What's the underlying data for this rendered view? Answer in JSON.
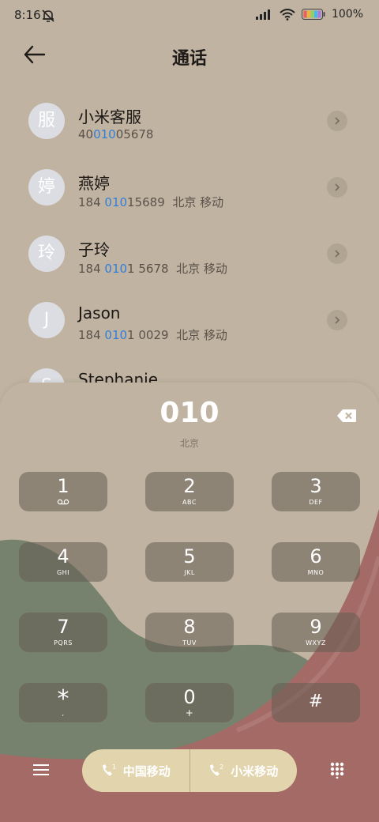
{
  "status_bar": {
    "time": "8:16",
    "battery": "100%"
  },
  "header": {
    "title": "通话"
  },
  "contacts": [
    {
      "avatar": "服",
      "name": "小米客服",
      "number_pre": "40",
      "number_hl": "010",
      "number_post": "05678",
      "location": ""
    },
    {
      "avatar": "婷",
      "name": "燕婷",
      "number_pre": "184 ",
      "number_hl": "010",
      "number_post": "15689",
      "location": "北京 移动"
    },
    {
      "avatar": "玲",
      "name": "子玲",
      "number_pre": "184 ",
      "number_hl": "010",
      "number_post": "1 5678",
      "location": "北京 移动"
    },
    {
      "avatar": "J",
      "name": "Jason",
      "number_pre": "184 ",
      "number_hl": "010",
      "number_post": "1 0029",
      "location": "北京 移动"
    },
    {
      "avatar": "S",
      "name": "Stephanie",
      "number_pre": "",
      "number_hl": "",
      "number_post": "",
      "location": ""
    }
  ],
  "dialer": {
    "number": "010",
    "location": "北京",
    "keys": [
      {
        "digit": "1",
        "letters": ""
      },
      {
        "digit": "2",
        "letters": "ABC"
      },
      {
        "digit": "3",
        "letters": "DEF"
      },
      {
        "digit": "4",
        "letters": "GHI"
      },
      {
        "digit": "5",
        "letters": "JKL"
      },
      {
        "digit": "6",
        "letters": "MNO"
      },
      {
        "digit": "7",
        "letters": "PQRS"
      },
      {
        "digit": "8",
        "letters": "TUV"
      },
      {
        "digit": "9",
        "letters": "WXYZ"
      },
      {
        "digit": "*",
        "letters": ","
      },
      {
        "digit": "0",
        "letters": "+"
      },
      {
        "digit": "#",
        "letters": ""
      }
    ]
  },
  "call_buttons": {
    "sim1_label": "中国移动",
    "sim1_badge": "1",
    "sim2_label": "小米移动",
    "sim2_badge": "2"
  },
  "colors": {
    "accent_blue": "#2f7fd9",
    "pill": "#e2d5ae",
    "background": "#c0b3a1"
  }
}
